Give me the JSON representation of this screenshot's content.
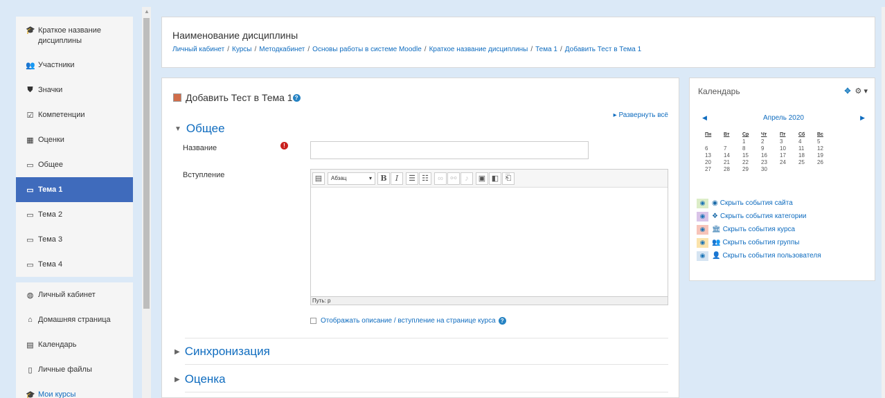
{
  "sidebar": {
    "course": [
      {
        "icon": "graduation-cap-icon",
        "glyph": "🎓",
        "label": "Краткое название дисциплины"
      },
      {
        "icon": "users-icon",
        "glyph": "👥",
        "label": "Участники"
      },
      {
        "icon": "shield-icon",
        "glyph": "⛊",
        "label": "Значки"
      },
      {
        "icon": "checkbox-icon",
        "glyph": "☑",
        "label": "Компетенции"
      },
      {
        "icon": "table-icon",
        "glyph": "▦",
        "label": "Оценки"
      },
      {
        "icon": "folder-icon",
        "glyph": "▭",
        "label": "Общее"
      },
      {
        "icon": "folder-icon",
        "glyph": "▭",
        "label": "Тема 1"
      },
      {
        "icon": "folder-icon",
        "glyph": "▭",
        "label": "Тема 2"
      },
      {
        "icon": "folder-icon",
        "glyph": "▭",
        "label": "Тема 3"
      },
      {
        "icon": "folder-icon",
        "glyph": "▭",
        "label": "Тема 4"
      }
    ],
    "site": [
      {
        "icon": "dashboard-icon",
        "glyph": "◍",
        "label": "Личный кабинет"
      },
      {
        "icon": "home-icon",
        "glyph": "⌂",
        "label": "Домашняя страница"
      },
      {
        "icon": "calendar-icon",
        "glyph": "▤",
        "label": "Календарь"
      },
      {
        "icon": "file-icon",
        "glyph": "▯",
        "label": "Личные файлы"
      },
      {
        "icon": "graduation-cap-icon",
        "glyph": "🎓",
        "label": "Мои курсы"
      }
    ]
  },
  "header": {
    "title": "Наименование дисциплины",
    "breadcrumb": [
      "Личный кабинет",
      "Курсы",
      "Методкабинет",
      "Основы работы в системе Moodle",
      "Краткое название дисциплины",
      "Тема 1",
      "Добавить Тест в Тема 1"
    ]
  },
  "main": {
    "heading": "Добавить Тест в Тема 1",
    "expand_all": "Развернуть всё",
    "section_general": "Общее",
    "name_label": "Название",
    "name_value": "",
    "intro_label": "Вступление",
    "editor_style": "Абзац",
    "editor_path": "Путь: p",
    "show_description": "Отображать описание / вступление на странице курса",
    "section_sync": "Синхронизация",
    "section_grade": "Оценка"
  },
  "calendar": {
    "title": "Календарь",
    "month": "Апрель 2020",
    "days": [
      "Пн",
      "Вт",
      "Ср",
      "Чт",
      "Пт",
      "Сб",
      "Вс"
    ],
    "weeks": [
      [
        "",
        "",
        "1",
        "2",
        "3",
        "4",
        "5"
      ],
      [
        "6",
        "7",
        "8",
        "9",
        "10",
        "11",
        "12"
      ],
      [
        "13",
        "14",
        "15",
        "16",
        "17",
        "18",
        "19"
      ],
      [
        "20",
        "21",
        "22",
        "23",
        "24",
        "25",
        "26"
      ],
      [
        "27",
        "28",
        "29",
        "30",
        "",
        "",
        ""
      ]
    ],
    "events": [
      {
        "label": "Скрыть события сайта",
        "color": "#dcedc8",
        "icon": "globe-icon",
        "glyph": "◉"
      },
      {
        "label": "Скрыть события категории",
        "color": "#d9c4e8",
        "icon": "cubes-icon",
        "glyph": "❖"
      },
      {
        "label": "Скрыть события курса",
        "color": "#f7c4b9",
        "icon": "university-icon",
        "glyph": "🏛"
      },
      {
        "label": "Скрыть события группы",
        "color": "#fbe3ab",
        "icon": "group-icon",
        "glyph": "👥"
      },
      {
        "label": "Скрыть события пользователя",
        "color": "#d5e4f2",
        "icon": "user-icon",
        "glyph": "👤"
      }
    ]
  },
  "colors": {
    "accent": "#0f6cbf",
    "active_nav": "#3f6bbc",
    "background": "#dbe9f7"
  }
}
